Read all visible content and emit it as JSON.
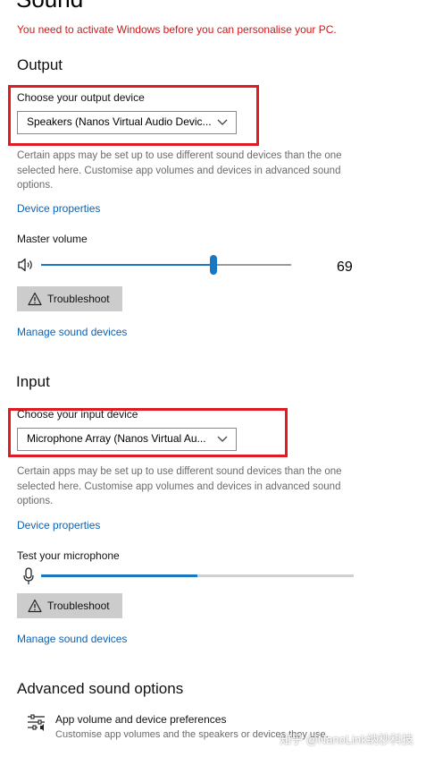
{
  "page": {
    "title": "Sound",
    "activation_warning": "You need to activate Windows before you can personalise your PC."
  },
  "output": {
    "heading": "Output",
    "device_label": "Choose your output device",
    "device_value": "Speakers (Nanos Virtual Audio Devic...",
    "description": "Certain apps may be set up to use different sound devices than the one selected here. Customise app volumes and devices in advanced sound options.",
    "device_properties_link": "Device properties",
    "master_volume_label": "Master volume",
    "master_volume_value": "69",
    "master_volume_fraction": 0.69,
    "troubleshoot_label": "Troubleshoot",
    "manage_link": "Manage sound devices"
  },
  "input": {
    "heading": "Input",
    "device_label": "Choose your input device",
    "device_value": "Microphone Array (Nanos Virtual Au...",
    "description": "Certain apps may be set up to use different sound devices than the one selected here. Customise app volumes and devices in advanced sound options.",
    "device_properties_link": "Device properties",
    "test_label": "Test your microphone",
    "mic_level_fraction": 0.5,
    "troubleshoot_label": "Troubleshoot",
    "manage_link": "Manage sound devices"
  },
  "advanced": {
    "heading": "Advanced sound options",
    "app_volume_title": "App volume and device preferences",
    "app_volume_desc": "Customise app volumes and the speakers or devices they use."
  },
  "watermark": "知乎 @NanoLink纳秒科技",
  "colors": {
    "accent": "#1a78c2",
    "link": "#0b63b5",
    "warning": "#d01818",
    "highlight_box": "#e01b24"
  },
  "icons": {
    "speaker": "speaker-icon",
    "microphone": "microphone-icon",
    "warning": "warning-icon",
    "chevron": "chevron-down-icon",
    "app_volume": "sliders-icon"
  }
}
